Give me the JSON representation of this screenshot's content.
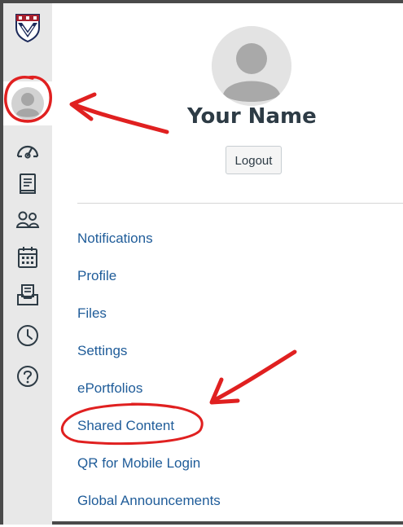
{
  "user": {
    "name": "Your Name",
    "logout_label": "Logout"
  },
  "nav_icons": [
    "university-shield-logo-icon",
    "account-avatar-icon",
    "dashboard-gauge-icon",
    "courses-book-icon",
    "groups-people-icon",
    "calendar-icon",
    "inbox-icon",
    "history-clock-icon",
    "help-question-icon"
  ],
  "menu": {
    "items": [
      {
        "label": "Notifications"
      },
      {
        "label": "Profile"
      },
      {
        "label": "Files"
      },
      {
        "label": "Settings"
      },
      {
        "label": "ePortfolios"
      },
      {
        "label": "Shared Content"
      },
      {
        "label": "QR for Mobile Login"
      },
      {
        "label": "Global Announcements"
      }
    ]
  },
  "colors": {
    "rail_bg": "#e8e8e8",
    "link": "#1f5c99",
    "name_text": "#2d3b45",
    "annotation_red": "#e02020",
    "logo_navy": "#1c2a5a",
    "logo_red": "#a8202e"
  }
}
